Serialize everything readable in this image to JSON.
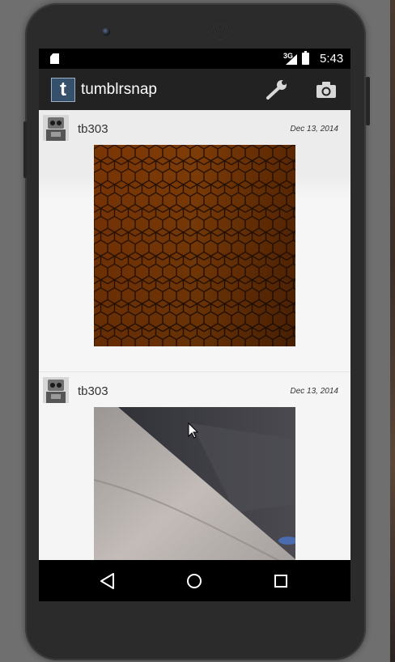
{
  "status_bar": {
    "network_type": "3G",
    "time": "5:43",
    "icons": [
      "sd-card-icon",
      "signal-icon",
      "battery-icon"
    ]
  },
  "action_bar": {
    "logo_letter": "t",
    "app_title": "tumblrsnap",
    "actions": [
      "wrench-icon",
      "camera-icon"
    ]
  },
  "feed": {
    "posts": [
      {
        "username": "tb303",
        "date": "Dec 13, 2014",
        "avatar": "robot-avatar",
        "photo": "orange honeycomb texture"
      },
      {
        "username": "tb303",
        "date": "Dec 13, 2014",
        "avatar": "robot-avatar",
        "photo": "couch cushion"
      }
    ]
  },
  "nav_bar": {
    "buttons": [
      "back-icon",
      "home-icon",
      "recents-icon"
    ]
  },
  "colors": {
    "action_bar_bg": "#222222",
    "logo_bg": "#34506b",
    "feed_bg": "#f6f6f6"
  }
}
